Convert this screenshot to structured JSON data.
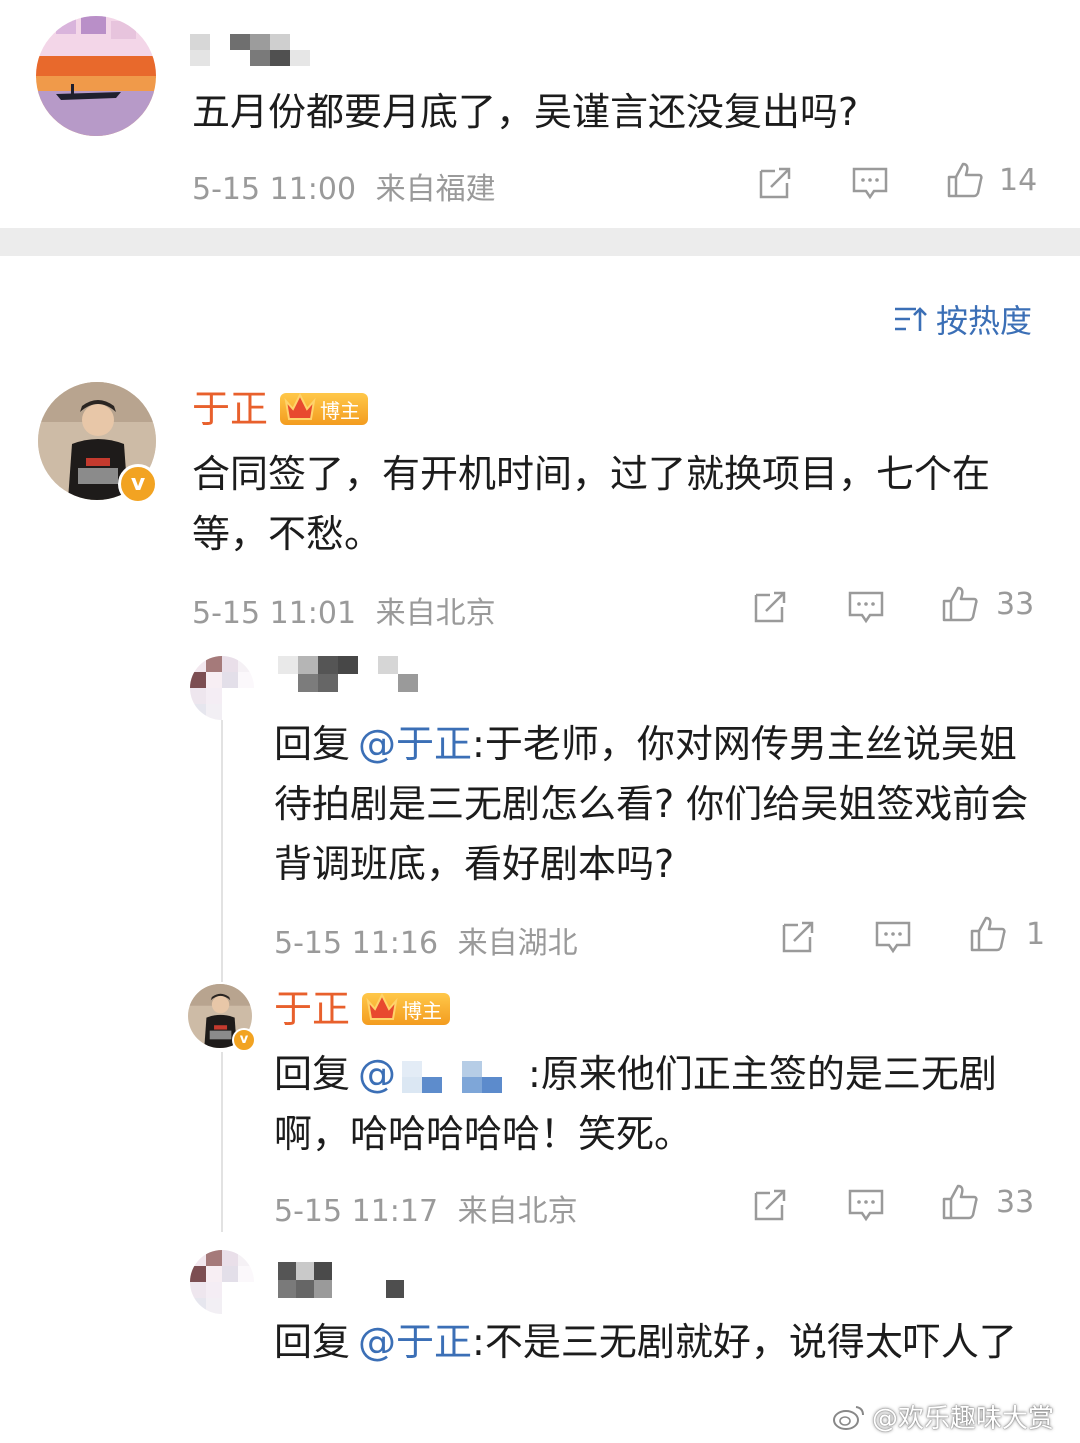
{
  "top_comment": {
    "text": "五月份都要月底了，吴谨言还没复出吗?",
    "time": "5-15 11:00",
    "location": "来自福建",
    "likes": "14"
  },
  "sort": {
    "icon": "sort-icon",
    "label": "按热度"
  },
  "main_comment": {
    "author": "于正",
    "badge": "博主",
    "text": "合同签了，有开机时间，过了就换项目，七个在等，不愁。",
    "time": "5-15 11:01",
    "location": "来自北京",
    "likes": "33"
  },
  "replies": [
    {
      "prefix": "回复",
      "mention": "@于正",
      "text": ":于老师，你对网传男主丝说吴姐待拍剧是三无剧怎么看? 你们给吴姐签戏前会背调班底，看好剧本吗?",
      "time": "5-15 11:16",
      "location": "来自湖北",
      "likes": "1"
    },
    {
      "author": "于正",
      "badge": "博主",
      "prefix": "回复",
      "mention": "@",
      "text": ":原来他们正主签的是三无剧啊，哈哈哈哈哈！笑死。",
      "time": "5-15 11:17",
      "location": "来自北京",
      "likes": "33"
    },
    {
      "prefix": "回复",
      "mention": "@于正",
      "text": ":不是三无剧就好，说得太吓人了"
    }
  ],
  "watermark": "@欢乐趣味大赏",
  "colors": {
    "accent_name": "#e8602c",
    "mention": "#3b6fb6",
    "meta": "#9a9a9a",
    "divider": "#ececec"
  }
}
